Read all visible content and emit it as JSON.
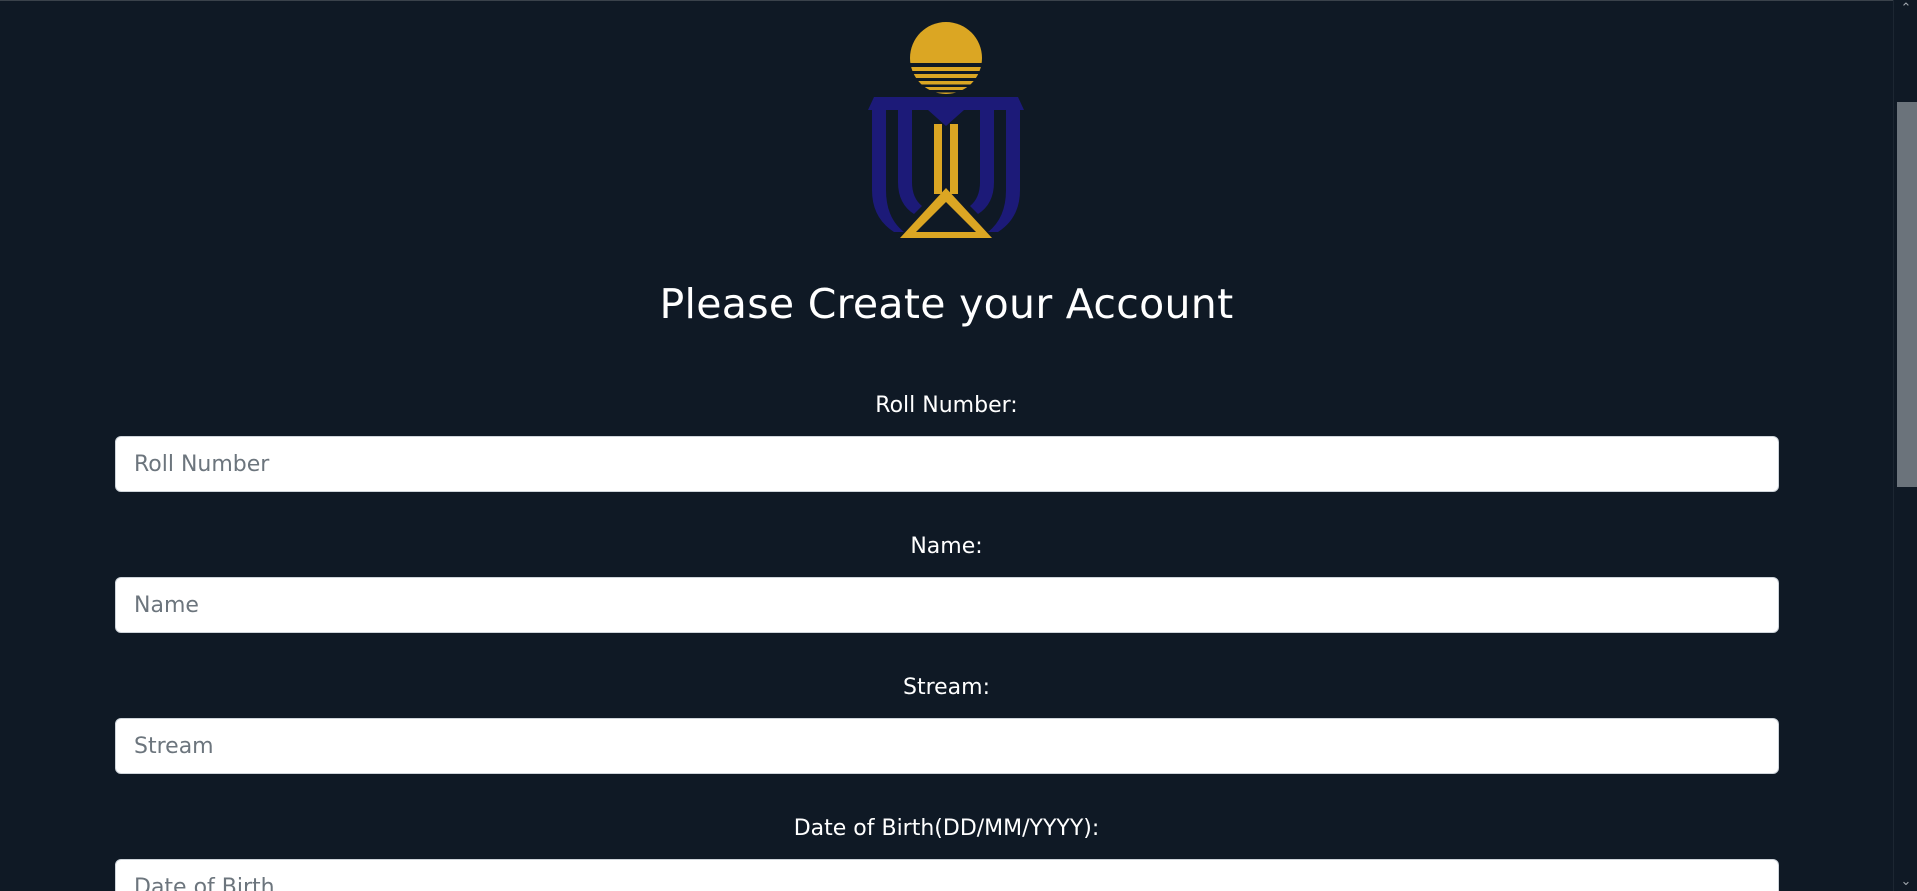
{
  "page": {
    "title": "Please Create your Account"
  },
  "colors": {
    "background": "#0f1925",
    "logo_gold": "#dba623",
    "logo_navy": "#1c1a78"
  },
  "form": {
    "fields": [
      {
        "label": "Roll Number:",
        "placeholder": "Roll Number",
        "value": ""
      },
      {
        "label": "Name:",
        "placeholder": "Name",
        "value": ""
      },
      {
        "label": "Stream:",
        "placeholder": "Stream",
        "value": ""
      },
      {
        "label": "Date of Birth(DD/MM/YYYY):",
        "placeholder": "Date of Birth",
        "value": ""
      }
    ]
  },
  "scrollbar": {
    "up_icon": "chevron-up-icon",
    "down_icon": "chevron-down-icon"
  }
}
